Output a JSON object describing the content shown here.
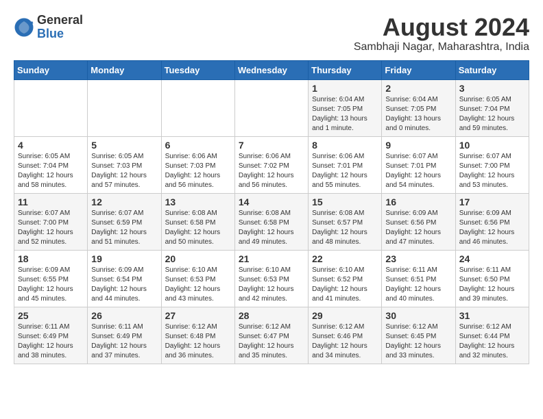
{
  "logo": {
    "general": "General",
    "blue": "Blue"
  },
  "title": {
    "month_year": "August 2024",
    "location": "Sambhaji Nagar, Maharashtra, India"
  },
  "headers": [
    "Sunday",
    "Monday",
    "Tuesday",
    "Wednesday",
    "Thursday",
    "Friday",
    "Saturday"
  ],
  "weeks": [
    [
      {
        "day": "",
        "info": ""
      },
      {
        "day": "",
        "info": ""
      },
      {
        "day": "",
        "info": ""
      },
      {
        "day": "",
        "info": ""
      },
      {
        "day": "1",
        "info": "Sunrise: 6:04 AM\nSunset: 7:05 PM\nDaylight: 13 hours\nand 1 minute."
      },
      {
        "day": "2",
        "info": "Sunrise: 6:04 AM\nSunset: 7:05 PM\nDaylight: 13 hours\nand 0 minutes."
      },
      {
        "day": "3",
        "info": "Sunrise: 6:05 AM\nSunset: 7:04 PM\nDaylight: 12 hours\nand 59 minutes."
      }
    ],
    [
      {
        "day": "4",
        "info": "Sunrise: 6:05 AM\nSunset: 7:04 PM\nDaylight: 12 hours\nand 58 minutes."
      },
      {
        "day": "5",
        "info": "Sunrise: 6:05 AM\nSunset: 7:03 PM\nDaylight: 12 hours\nand 57 minutes."
      },
      {
        "day": "6",
        "info": "Sunrise: 6:06 AM\nSunset: 7:03 PM\nDaylight: 12 hours\nand 56 minutes."
      },
      {
        "day": "7",
        "info": "Sunrise: 6:06 AM\nSunset: 7:02 PM\nDaylight: 12 hours\nand 56 minutes."
      },
      {
        "day": "8",
        "info": "Sunrise: 6:06 AM\nSunset: 7:01 PM\nDaylight: 12 hours\nand 55 minutes."
      },
      {
        "day": "9",
        "info": "Sunrise: 6:07 AM\nSunset: 7:01 PM\nDaylight: 12 hours\nand 54 minutes."
      },
      {
        "day": "10",
        "info": "Sunrise: 6:07 AM\nSunset: 7:00 PM\nDaylight: 12 hours\nand 53 minutes."
      }
    ],
    [
      {
        "day": "11",
        "info": "Sunrise: 6:07 AM\nSunset: 7:00 PM\nDaylight: 12 hours\nand 52 minutes."
      },
      {
        "day": "12",
        "info": "Sunrise: 6:07 AM\nSunset: 6:59 PM\nDaylight: 12 hours\nand 51 minutes."
      },
      {
        "day": "13",
        "info": "Sunrise: 6:08 AM\nSunset: 6:58 PM\nDaylight: 12 hours\nand 50 minutes."
      },
      {
        "day": "14",
        "info": "Sunrise: 6:08 AM\nSunset: 6:58 PM\nDaylight: 12 hours\nand 49 minutes."
      },
      {
        "day": "15",
        "info": "Sunrise: 6:08 AM\nSunset: 6:57 PM\nDaylight: 12 hours\nand 48 minutes."
      },
      {
        "day": "16",
        "info": "Sunrise: 6:09 AM\nSunset: 6:56 PM\nDaylight: 12 hours\nand 47 minutes."
      },
      {
        "day": "17",
        "info": "Sunrise: 6:09 AM\nSunset: 6:56 PM\nDaylight: 12 hours\nand 46 minutes."
      }
    ],
    [
      {
        "day": "18",
        "info": "Sunrise: 6:09 AM\nSunset: 6:55 PM\nDaylight: 12 hours\nand 45 minutes."
      },
      {
        "day": "19",
        "info": "Sunrise: 6:09 AM\nSunset: 6:54 PM\nDaylight: 12 hours\nand 44 minutes."
      },
      {
        "day": "20",
        "info": "Sunrise: 6:10 AM\nSunset: 6:53 PM\nDaylight: 12 hours\nand 43 minutes."
      },
      {
        "day": "21",
        "info": "Sunrise: 6:10 AM\nSunset: 6:53 PM\nDaylight: 12 hours\nand 42 minutes."
      },
      {
        "day": "22",
        "info": "Sunrise: 6:10 AM\nSunset: 6:52 PM\nDaylight: 12 hours\nand 41 minutes."
      },
      {
        "day": "23",
        "info": "Sunrise: 6:11 AM\nSunset: 6:51 PM\nDaylight: 12 hours\nand 40 minutes."
      },
      {
        "day": "24",
        "info": "Sunrise: 6:11 AM\nSunset: 6:50 PM\nDaylight: 12 hours\nand 39 minutes."
      }
    ],
    [
      {
        "day": "25",
        "info": "Sunrise: 6:11 AM\nSunset: 6:49 PM\nDaylight: 12 hours\nand 38 minutes."
      },
      {
        "day": "26",
        "info": "Sunrise: 6:11 AM\nSunset: 6:49 PM\nDaylight: 12 hours\nand 37 minutes."
      },
      {
        "day": "27",
        "info": "Sunrise: 6:12 AM\nSunset: 6:48 PM\nDaylight: 12 hours\nand 36 minutes."
      },
      {
        "day": "28",
        "info": "Sunrise: 6:12 AM\nSunset: 6:47 PM\nDaylight: 12 hours\nand 35 minutes."
      },
      {
        "day": "29",
        "info": "Sunrise: 6:12 AM\nSunset: 6:46 PM\nDaylight: 12 hours\nand 34 minutes."
      },
      {
        "day": "30",
        "info": "Sunrise: 6:12 AM\nSunset: 6:45 PM\nDaylight: 12 hours\nand 33 minutes."
      },
      {
        "day": "31",
        "info": "Sunrise: 6:12 AM\nSunset: 6:44 PM\nDaylight: 12 hours\nand 32 minutes."
      }
    ]
  ]
}
